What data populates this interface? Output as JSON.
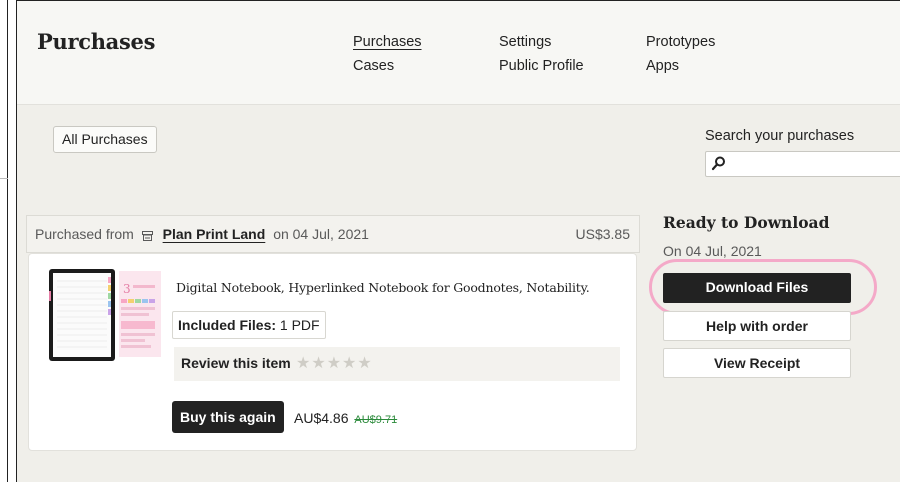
{
  "header": {
    "title": "Purchases",
    "nav": [
      {
        "label": "Purchases",
        "active": true
      },
      {
        "label": "Settings",
        "active": false
      },
      {
        "label": "Prototypes",
        "active": false
      },
      {
        "label": "Cases",
        "active": false
      },
      {
        "label": "Public Profile",
        "active": false
      },
      {
        "label": "Apps",
        "active": false
      }
    ]
  },
  "filter": {
    "label": "All Purchases"
  },
  "search": {
    "label": "Search your purchases",
    "value": "",
    "icon": "search-icon"
  },
  "purchase": {
    "purchased_from": "Purchased from",
    "shop_icon": "shop-icon",
    "shop_name": "Plan Print Land",
    "on_date": "on 04 Jul, 2021",
    "total": "US$3.85"
  },
  "item": {
    "title": "Digital Notebook, Hyperlinked Notebook for Goodnotes, Notability.",
    "included_label": "Included Files:",
    "included_value": "1 PDF",
    "review_label": "Review this item",
    "rating": 0,
    "rating_max": 5,
    "buy_again": "Buy this again",
    "price": "AU$4.86",
    "original_price": "AU$9.71"
  },
  "download": {
    "title": "Ready to Download",
    "date": "On 04 Jul, 2021",
    "download_button": "Download Files",
    "help_button": "Help with order",
    "receipt_button": "View Receipt"
  },
  "colors": {
    "accent_dark": "#222222",
    "highlight_ring": "#f4a9c8",
    "original_price": "#2a8a3a",
    "background": "#f0efea"
  }
}
